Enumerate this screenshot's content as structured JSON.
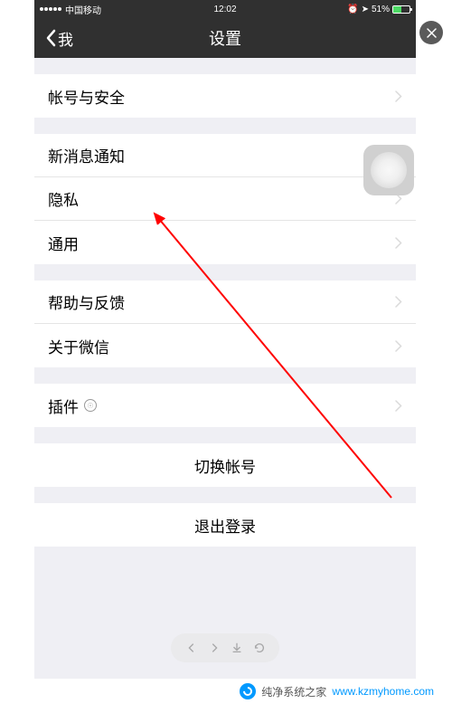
{
  "statusBar": {
    "carrier": "中国移动",
    "time": "12:02",
    "battery": "51%"
  },
  "navBar": {
    "backLabel": "我",
    "title": "设置"
  },
  "sections": {
    "s1": {
      "account": "帐号与安全"
    },
    "s2": {
      "notifications": "新消息通知",
      "privacy": "隐私",
      "general": "通用"
    },
    "s3": {
      "help": "帮助与反馈",
      "about": "关于微信"
    },
    "s4": {
      "plugins": "插件"
    },
    "s5": {
      "switchAccount": "切换帐号"
    },
    "s6": {
      "logout": "退出登录"
    }
  },
  "watermark": {
    "text": "纯净系统之家",
    "url": "www.kzmyhome.com"
  }
}
